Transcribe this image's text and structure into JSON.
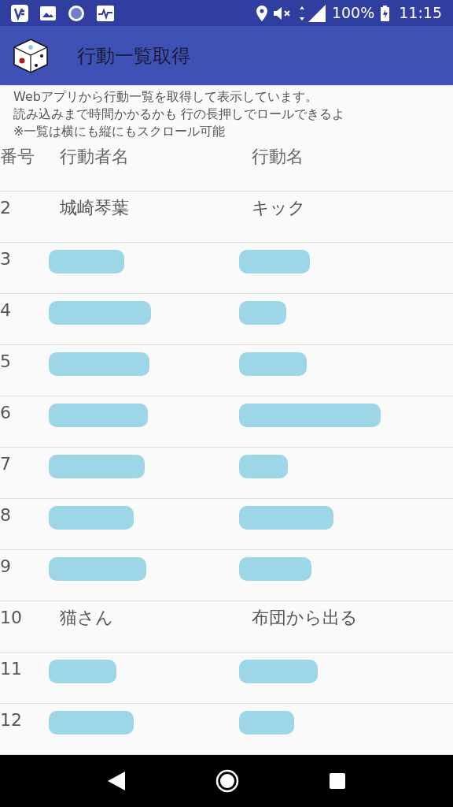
{
  "status_bar": {
    "battery": "100%",
    "time": "11:15"
  },
  "app_bar": {
    "title": "行動一覧取得"
  },
  "intro": [
    "Webアプリから行動一覧を取得して表示しています。",
    "読み込みまで時間かかるかも 行の長押しでロールできるよ",
    "※一覧は横にも縦にもスクロール可能"
  ],
  "table": {
    "columns": [
      "番号",
      "行動者名",
      "行動名"
    ],
    "rows": [
      {
        "number": "2",
        "actor": {
          "kind": "text",
          "text": "城崎琴葉"
        },
        "action": {
          "kind": "text",
          "text": "キック"
        }
      },
      {
        "number": "3",
        "actor": {
          "kind": "redacted"
        },
        "action": {
          "kind": "redacted"
        }
      },
      {
        "number": "4",
        "actor": {
          "kind": "redacted"
        },
        "action": {
          "kind": "redacted"
        }
      },
      {
        "number": "5",
        "actor": {
          "kind": "redacted"
        },
        "action": {
          "kind": "redacted"
        }
      },
      {
        "number": "6",
        "actor": {
          "kind": "redacted"
        },
        "action": {
          "kind": "redacted"
        }
      },
      {
        "number": "7",
        "actor": {
          "kind": "redacted"
        },
        "action": {
          "kind": "redacted"
        }
      },
      {
        "number": "8",
        "actor": {
          "kind": "redacted"
        },
        "action": {
          "kind": "redacted"
        }
      },
      {
        "number": "9",
        "actor": {
          "kind": "redacted"
        },
        "action": {
          "kind": "redacted"
        }
      },
      {
        "number": "10",
        "actor": {
          "kind": "text",
          "text": "猫さん"
        },
        "action": {
          "kind": "text",
          "text": "布団から出る"
        }
      },
      {
        "number": "11",
        "actor": {
          "kind": "redacted"
        },
        "action": {
          "kind": "redacted"
        }
      },
      {
        "number": "12",
        "actor": {
          "kind": "redacted"
        },
        "action": {
          "kind": "redacted"
        }
      }
    ]
  }
}
